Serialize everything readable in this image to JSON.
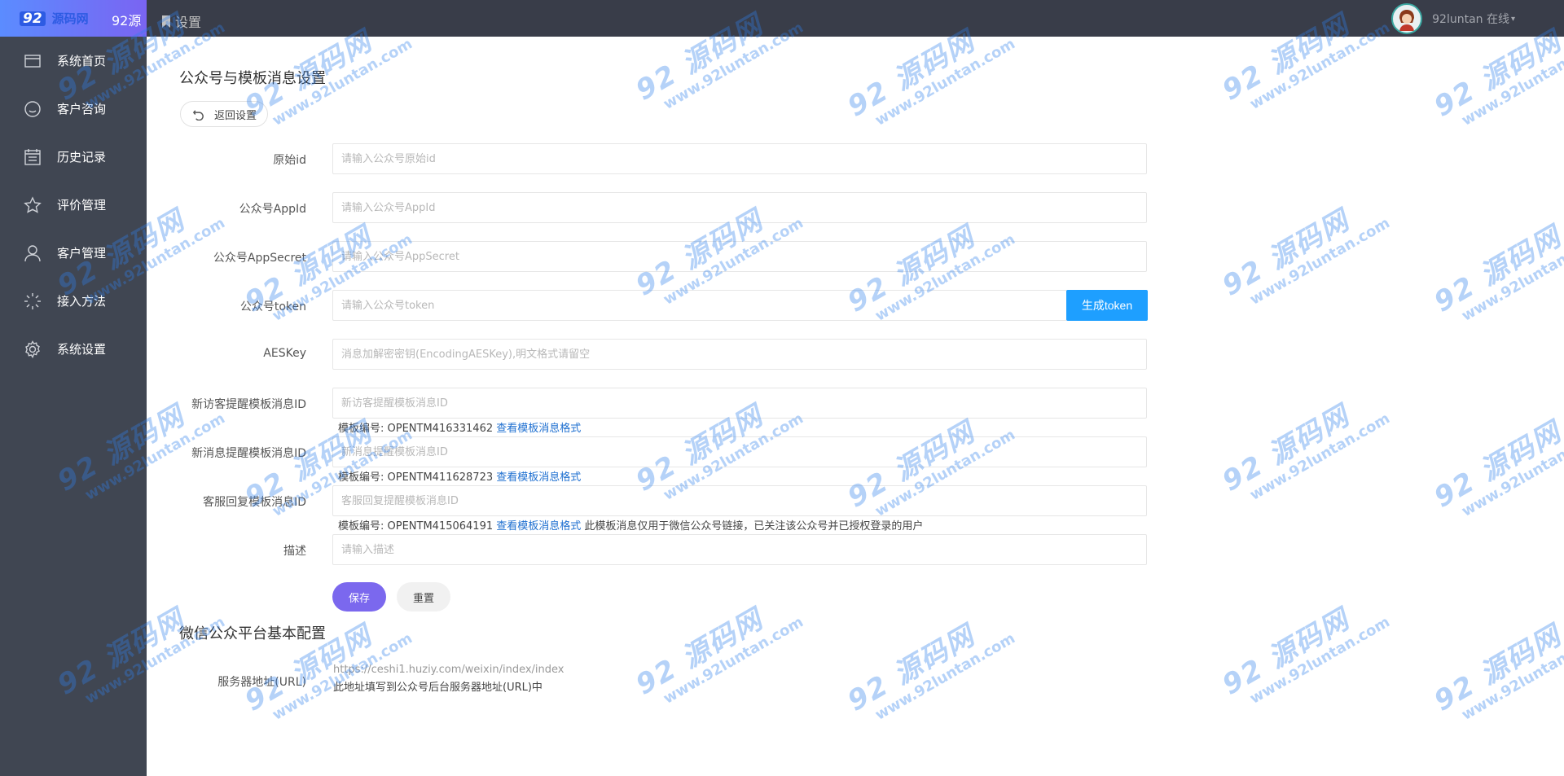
{
  "brand": {
    "logo": "92",
    "logo_cn": "源码网",
    "name": "92源"
  },
  "header": {
    "page_title": "设置"
  },
  "user": {
    "name": "92luntan 在线"
  },
  "sidebar": {
    "items": [
      {
        "label": "系统首页",
        "icon": "window-icon"
      },
      {
        "label": "客户咨询",
        "icon": "smile-icon"
      },
      {
        "label": "历史记录",
        "icon": "calendar-list-icon"
      },
      {
        "label": "评价管理",
        "icon": "star-icon"
      },
      {
        "label": "客户管理",
        "icon": "user-icon"
      },
      {
        "label": "接入方法",
        "icon": "loading-icon"
      },
      {
        "label": "系统设置",
        "icon": "gear-icon"
      }
    ]
  },
  "main": {
    "title": "公众号与模板消息设置",
    "back_label": "返回设置",
    "fields": [
      {
        "label": "原始id",
        "placeholder": "请输入公众号原始id"
      },
      {
        "label": "公众号AppId",
        "placeholder": "请输入公众号AppId"
      },
      {
        "label": "公众号AppSecret",
        "placeholder": "请输入公众号AppSecret"
      },
      {
        "label": "公众号token",
        "placeholder": "请输入公众号token"
      },
      {
        "label": "AESKey",
        "placeholder": "消息加解密密钥(EncodingAESKey),明文格式请留空"
      },
      {
        "label": "新访客提醒模板消息ID",
        "placeholder": "新访客提醒模板消息ID"
      },
      {
        "label": "新消息提醒模板消息ID",
        "placeholder": "新消息提醒模板消息ID"
      },
      {
        "label": "客服回复模板消息ID",
        "placeholder": "客服回复提醒模板消息ID"
      },
      {
        "label": "描述",
        "placeholder": "请输入描述"
      }
    ],
    "generate_token": "生成token",
    "hints": [
      {
        "prefix": "模板编号: OPENTM416331462",
        "link": "查看模板消息格式",
        "suffix": ""
      },
      {
        "prefix": "模板编号: OPENTM411628723",
        "link": "查看模板消息格式",
        "suffix": ""
      },
      {
        "prefix": "模板编号: OPENTM415064191",
        "link": "查看模板消息格式",
        "suffix": " 此模板消息仅用于微信公众号链接，已关注该公众号并已授权登录的用户"
      }
    ],
    "save_label": "保存",
    "reset_label": "重置",
    "section2_title": "微信公众平台基本配置",
    "server_url_label": "服务器地址(URL)",
    "server_url": "https://ceshi1.huziy.com/weixin/index/index",
    "server_url_note": "此地址填写到公众号后台服务器地址(URL)中"
  },
  "watermark": {
    "line1": "92 源码网",
    "line2": "www.92luntan.com"
  },
  "colors": {
    "topbar": "#393d49",
    "sidebar": "#404652",
    "primary": "#7b68ee",
    "token_button": "#1e9fff",
    "link": "#1e6fd0"
  }
}
